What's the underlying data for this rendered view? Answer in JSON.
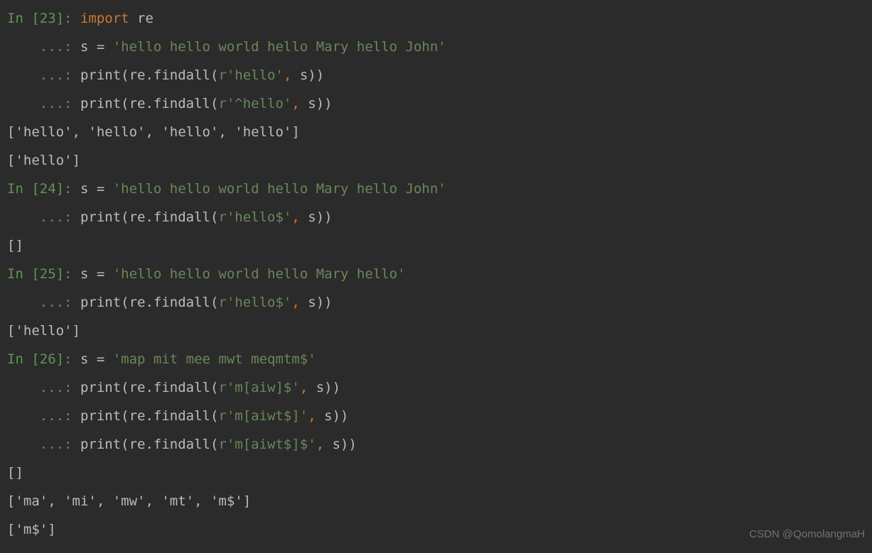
{
  "cells": [
    {
      "prompt": "In [23]: ",
      "lines": [
        [
          {
            "t": "kw",
            "v": "import"
          },
          {
            "t": "punc",
            "v": " re"
          }
        ],
        [
          {
            "t": "punc",
            "v": "s = "
          },
          {
            "t": "str",
            "v": "'hello hello world hello Mary hello John'"
          }
        ],
        [
          {
            "t": "punc",
            "v": "print(re.findall("
          },
          {
            "t": "str",
            "v": "r'hello'"
          },
          {
            "t": "comma-highlight",
            "v": ", "
          },
          {
            "t": "punc",
            "v": "s))"
          }
        ],
        [
          {
            "t": "punc",
            "v": "print(re.findall("
          },
          {
            "t": "str",
            "v": "r'^hello'"
          },
          {
            "t": "comma-highlight",
            "v": ", "
          },
          {
            "t": "punc",
            "v": "s))"
          }
        ]
      ],
      "outputs": [
        "['hello', 'hello', 'hello', 'hello']",
        "['hello']"
      ]
    },
    {
      "prompt": "In [24]: ",
      "lines": [
        [
          {
            "t": "punc",
            "v": "s = "
          },
          {
            "t": "str",
            "v": "'hello hello world hello Mary hello John'"
          }
        ],
        [
          {
            "t": "punc",
            "v": "print(re.findall("
          },
          {
            "t": "str",
            "v": "r'hello$'"
          },
          {
            "t": "comma-highlight",
            "v": ", "
          },
          {
            "t": "punc",
            "v": "s))"
          }
        ]
      ],
      "outputs": [
        "[]"
      ]
    },
    {
      "prompt": "In [25]: ",
      "lines": [
        [
          {
            "t": "punc",
            "v": "s = "
          },
          {
            "t": "str",
            "v": "'hello hello world hello Mary hello'"
          }
        ],
        [
          {
            "t": "punc",
            "v": "print(re.findall("
          },
          {
            "t": "str",
            "v": "r'hello$'"
          },
          {
            "t": "comma-highlight",
            "v": ", "
          },
          {
            "t": "punc",
            "v": "s))"
          }
        ]
      ],
      "outputs": [
        "['hello']"
      ]
    },
    {
      "prompt": "In [26]: ",
      "lines": [
        [
          {
            "t": "punc",
            "v": "s = "
          },
          {
            "t": "str",
            "v": "'map mit mee mwt meqmtm$'"
          }
        ],
        [
          {
            "t": "punc",
            "v": "print(re.findall("
          },
          {
            "t": "str",
            "v": "r'm[aiw]$'"
          },
          {
            "t": "comma-highlight",
            "v": ", "
          },
          {
            "t": "punc",
            "v": "s))"
          }
        ],
        [
          {
            "t": "punc",
            "v": "print(re.findall("
          },
          {
            "t": "str",
            "v": "r'm[aiwt$]'"
          },
          {
            "t": "comma-highlight",
            "v": ", "
          },
          {
            "t": "punc",
            "v": "s))"
          }
        ],
        [
          {
            "t": "punc",
            "v": "print(re.findall("
          },
          {
            "t": "str",
            "v": "r'm[aiwt$]$'"
          },
          {
            "t": "comma-highlight",
            "v": ", "
          },
          {
            "t": "punc",
            "v": "s))"
          }
        ]
      ],
      "outputs": [
        "[]",
        "['ma', 'mi', 'mw', 'mt', 'm$']",
        "['m$']"
      ]
    }
  ],
  "continuation": "    ...: ",
  "watermark": "CSDN @QomolangmaH"
}
